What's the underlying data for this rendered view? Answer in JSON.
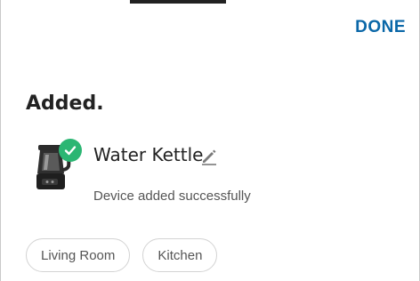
{
  "header": {
    "done_label": "DONE"
  },
  "main": {
    "title": "Added."
  },
  "device": {
    "name": "Water Kettle",
    "status": "Device added successfully",
    "image_icon": "kettle-icon",
    "badge_icon": "check-icon",
    "edit_icon": "pencil-icon"
  },
  "rooms": [
    {
      "label": "Living Room"
    },
    {
      "label": "Kitchen"
    }
  ],
  "colors": {
    "accent": "#0a67a8",
    "success": "#2bb673",
    "text": "#222222",
    "muted": "#555555"
  }
}
